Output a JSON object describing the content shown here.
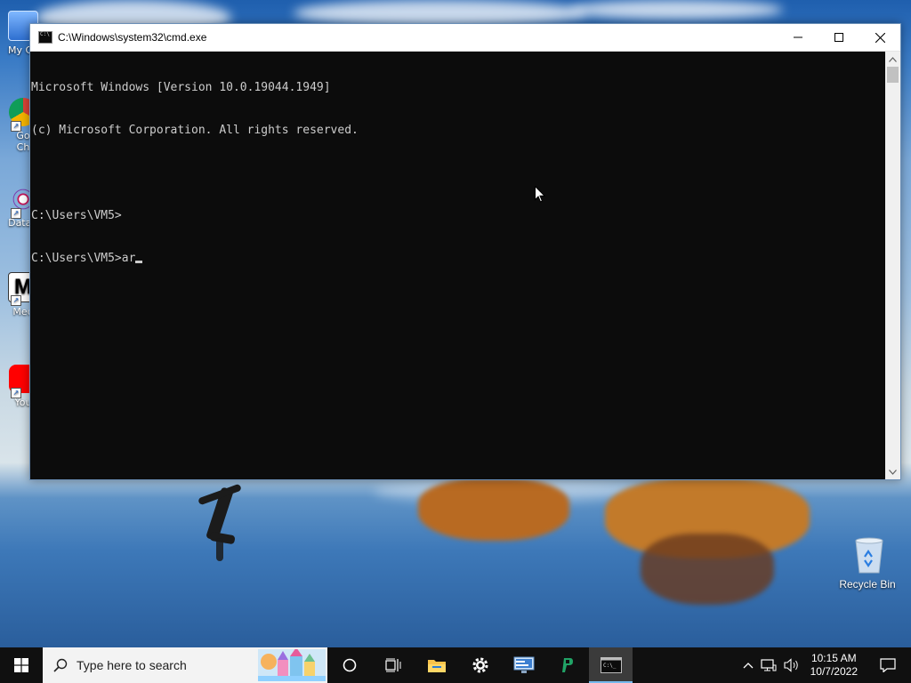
{
  "desktop": {
    "icons": [
      {
        "label": "My Co",
        "icon": "computer-icon"
      },
      {
        "label": "Go\nCh",
        "icon": "chrome-icon"
      },
      {
        "label": "DataV",
        "icon": "datavis-icon"
      },
      {
        "label": "Med",
        "icon": "media-icon"
      },
      {
        "label": "You",
        "icon": "youtube-icon"
      }
    ],
    "recycle_bin": {
      "label": "Recycle Bin",
      "icon": "recycle-bin-icon"
    }
  },
  "cmd_window": {
    "title": "C:\\Windows\\system32\\cmd.exe",
    "controls": {
      "minimize": "minimize-icon",
      "maximize": "maximize-icon",
      "close": "close-icon"
    },
    "lines": [
      "Microsoft Windows [Version 10.0.19044.1949]",
      "(c) Microsoft Corporation. All rights reserved.",
      "",
      "C:\\Users\\VM5>",
      "C:\\Users\\VM5>ar"
    ]
  },
  "taskbar": {
    "search_placeholder": "Type here to search",
    "pinned": [
      {
        "name": "cortana-icon"
      },
      {
        "name": "task-view-icon"
      },
      {
        "name": "file-explorer-icon"
      },
      {
        "name": "settings-icon"
      },
      {
        "name": "remote-desktop-icon"
      },
      {
        "name": "green-app-icon"
      },
      {
        "name": "cmd-icon",
        "active": true
      }
    ],
    "tray": {
      "time": "10:15 AM",
      "date": "10/7/2022",
      "icons": [
        "chevron-up-icon",
        "network-icon",
        "volume-icon",
        "notification-icon"
      ]
    }
  },
  "colors": {
    "console_bg": "#0c0c0c",
    "console_text": "#cccccc",
    "taskbar_bg": "#101010",
    "accent": "#76b9ed"
  }
}
